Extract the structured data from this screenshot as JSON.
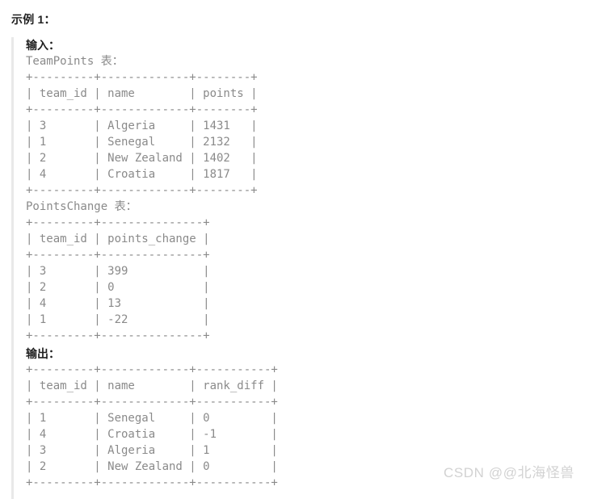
{
  "page": {
    "title": "示例 1：",
    "background_color": "#ffffff",
    "quote_bar_color": "#e9e9e9",
    "code_text_color": "#8a8a8a",
    "heading_text_color": "#1f1f1f"
  },
  "sections": {
    "input": {
      "label": "输入：",
      "tables": [
        {
          "caption": "TeamPoints 表：",
          "lines": [
            "+---------+-------------+--------+",
            "| team_id | name        | points |",
            "+---------+-------------+--------+",
            "| 3       | Algeria     | 1431   |",
            "| 1       | Senegal     | 2132   |",
            "| 2       | New Zealand | 1402   |",
            "| 4       | Croatia     | 1817   |",
            "+---------+-------------+--------+"
          ],
          "name": "TeamPoints",
          "columns": [
            "team_id",
            "name",
            "points"
          ],
          "rows": [
            [
              "3",
              "Algeria",
              "1431"
            ],
            [
              "1",
              "Senegal",
              "2132"
            ],
            [
              "2",
              "New Zealand",
              "1402"
            ],
            [
              "4",
              "Croatia",
              "1817"
            ]
          ]
        },
        {
          "caption": "PointsChange 表：",
          "lines": [
            "+---------+---------------+",
            "| team_id | points_change |",
            "+---------+---------------+",
            "| 3       | 399           |",
            "| 2       | 0             |",
            "| 4       | 13            |",
            "| 1       | -22           |",
            "+---------+---------------+"
          ],
          "name": "PointsChange",
          "columns": [
            "team_id",
            "points_change"
          ],
          "rows": [
            [
              "3",
              "399"
            ],
            [
              "2",
              "0"
            ],
            [
              "4",
              "13"
            ],
            [
              "1",
              "-22"
            ]
          ]
        }
      ]
    },
    "output": {
      "label": "输出：",
      "tables": [
        {
          "caption": "",
          "lines": [
            "+---------+-------------+-----------+",
            "| team_id | name        | rank_diff |",
            "+---------+-------------+-----------+",
            "| 1       | Senegal     | 0         |",
            "| 4       | Croatia     | -1        |",
            "| 3       | Algeria     | 1         |",
            "| 2       | New Zealand | 0         |",
            "+---------+-------------+-----------+"
          ],
          "columns": [
            "team_id",
            "name",
            "rank_diff"
          ],
          "rows": [
            [
              "1",
              "Senegal",
              "0"
            ],
            [
              "4",
              "Croatia",
              "-1"
            ],
            [
              "3",
              "Algeria",
              "1"
            ],
            [
              "2",
              "New Zealand",
              "0"
            ]
          ]
        }
      ]
    }
  },
  "watermark": {
    "text": "CSDN @@北海怪兽"
  }
}
